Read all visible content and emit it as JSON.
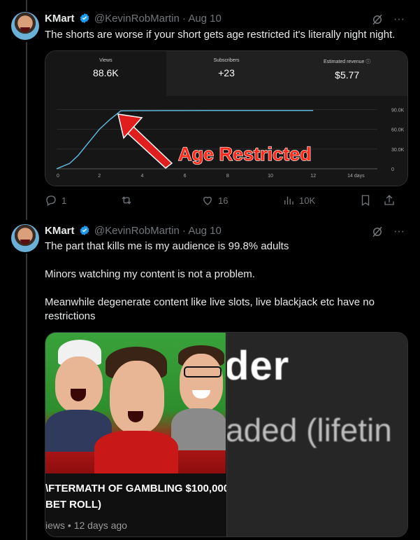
{
  "tweets": [
    {
      "name": "KMart",
      "handle": "@KevinRobMartin",
      "date": "Aug 10",
      "text": "The shorts are worse if your short gets age restricted it's literally night night.",
      "media": {
        "metrics": [
          {
            "label": "Views",
            "value": "88.6K"
          },
          {
            "label": "Subscribers",
            "value": "+23"
          },
          {
            "label": "Estimated revenue",
            "value": "$5.77"
          }
        ],
        "annotation": "Age Restricted",
        "chart_data": {
          "type": "line",
          "x_ticks": [
            "0",
            "2",
            "4",
            "6",
            "8",
            "10",
            "12",
            "14 days"
          ],
          "y_ticks": [
            "0",
            "30.0K",
            "60.0K",
            "90.0K"
          ],
          "ylim": [
            0,
            100000
          ],
          "xlim": [
            0,
            15
          ],
          "series": [
            {
              "x": [
                0,
                0.3,
                0.6,
                1,
                1.5,
                2,
                2.5,
                3,
                4,
                5,
                6,
                7,
                8,
                9,
                10,
                11,
                12
              ],
              "values": [
                0,
                4000,
                8000,
                20000,
                40000,
                60000,
                75000,
                88000,
                88300,
                88400,
                88450,
                88500,
                88520,
                88550,
                88570,
                88590,
                88600
              ]
            }
          ],
          "color": "#5fb3d9"
        }
      },
      "actions": {
        "replies": "1",
        "retweets": "",
        "likes": "16",
        "views": "10K"
      }
    },
    {
      "name": "KMart",
      "handle": "@KevinRobMartin",
      "date": "Aug 10",
      "paragraphs": [
        "The part that kills me is my audience is 99.8% adults",
        "Minors watching my content is not a problem.",
        "Meanwhile degenerate content like live slots, live blackjack etc have no restrictions"
      ],
      "video": {
        "title_line1": "\\FTERMATH OF GAMBLING $100,000",
        "title_line2": " BET ROLL)",
        "meta": "iews • 12 days ago",
        "zoom_line1": "der",
        "zoom_line2": "aded (lifetin"
      }
    }
  ],
  "colors": {
    "verified": "#1d9bf0",
    "arrow": "#e01e1e",
    "annotation_fill": "#ff2a1a"
  }
}
